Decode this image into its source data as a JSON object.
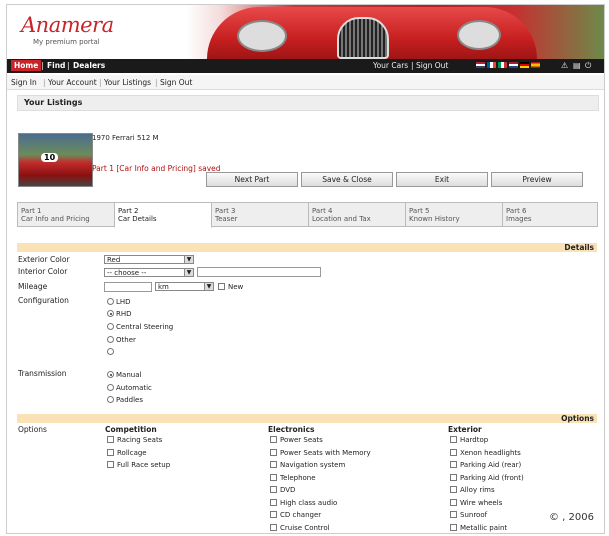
{
  "brand": {
    "logo": "Anamera",
    "tagline": "My premium portal"
  },
  "nav": {
    "home": "Home",
    "find": "Find",
    "dealers": "Dealers",
    "your_cars": "Your Cars",
    "sign_out": "Sign Out"
  },
  "subnav": [
    "Sign In",
    "Your Account",
    "Your Listings",
    "Sign Out"
  ],
  "section_title": "Your Listings",
  "listing": {
    "title": "1970 Ferrari 512 M",
    "thumb_number": "10",
    "saved_message": "Part 1 [Car Info and Pricing] saved"
  },
  "buttons": {
    "next": "Next Part",
    "save_close": "Save & Close",
    "exit": "Exit",
    "preview": "Preview"
  },
  "tabs": [
    {
      "part": "Part 1",
      "title": "Car Info and Pricing"
    },
    {
      "part": "Part 2",
      "title": "Car Details"
    },
    {
      "part": "Part 3",
      "title": "Teaser"
    },
    {
      "part": "Part 4",
      "title": "Location and Tax"
    },
    {
      "part": "Part 5",
      "title": "Known History"
    },
    {
      "part": "Part 6",
      "title": "Images"
    }
  ],
  "details": {
    "band": "Details",
    "exterior_label": "Exterior Color",
    "exterior_value": "Red",
    "interior_label": "Interior Color",
    "interior_value": "-- choose --",
    "mileage_label": "Mileage",
    "mileage_unit": "km",
    "new_label": "New",
    "config_label": "Configuration",
    "config_options": [
      "LHD",
      "RHD",
      "Central Steering",
      "Other",
      ""
    ],
    "transmission_label": "Transmission",
    "transmission_options": [
      "Manual",
      "Automatic",
      "Paddles"
    ]
  },
  "options": {
    "band": "Options",
    "label": "Options",
    "competition_head": "Competition",
    "competition": [
      "Racing Seats",
      "Rollcage",
      "Full Race setup"
    ],
    "electronics_head": "Electronics",
    "electronics": [
      "Power Seats",
      "Power Seats with Memory",
      "Navigation system",
      "Telephone",
      "DVD",
      "High class audio",
      "CD changer",
      "Cruise Control"
    ],
    "exterior_head": "Exterior",
    "exterior": [
      "Hardtop",
      "Xenon headlights",
      "Parking Aid (rear)",
      "Parking Aid (front)",
      "Alloy rims",
      "Wire wheels",
      "Sunroof",
      "Metallic paint"
    ]
  },
  "copyright": "© , 2006",
  "colors": {
    "brand_red": "#c8242a",
    "band": "#fbe2b6",
    "error": "#b01010"
  }
}
